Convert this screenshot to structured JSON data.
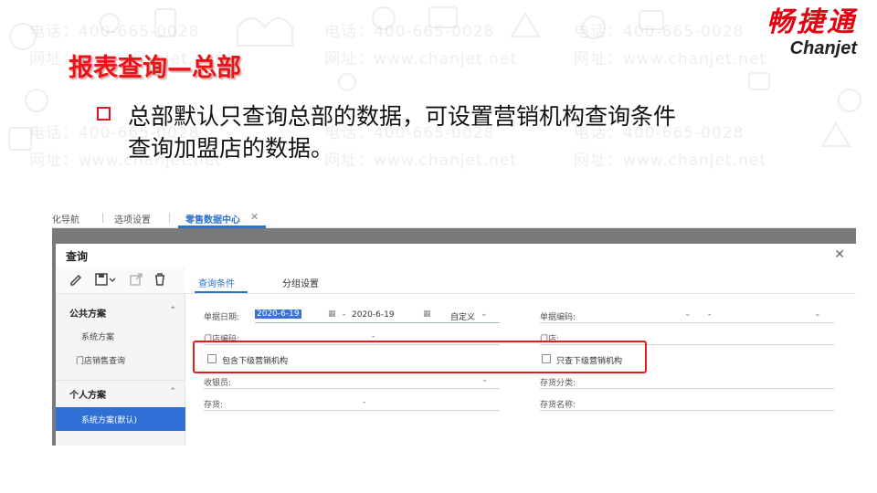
{
  "watermark": {
    "phone": "电话：400-665-0028",
    "url": "网址：www.chanjet.net"
  },
  "logo": {
    "cn": "畅捷通",
    "en": "Chanjet"
  },
  "slide": {
    "title": "报表查询—总部",
    "bullet_line1": "总部默认只查询总部的数据，可设置营销机构查询条件",
    "bullet_line2": "查询加盟店的数据。"
  },
  "app": {
    "tabs": [
      {
        "label": "化导航"
      },
      {
        "label": "选项设置"
      },
      {
        "label": "零售数据中心",
        "active": true
      }
    ],
    "dialog": {
      "title": "查询",
      "toolbar_icons": [
        "edit-icon",
        "save-icon",
        "export-icon",
        "delete-icon"
      ],
      "sections": [
        {
          "label": "公共方案",
          "items": [
            "系统方案",
            "门店销售查询"
          ]
        },
        {
          "label": "个人方案",
          "items": [
            "系统方案(默认)"
          ]
        }
      ],
      "query_tabs": [
        "查询条件",
        "分组设置"
      ],
      "form": {
        "date_label": "单据日期:",
        "date_from": "2020-6-19",
        "date_sep": "-",
        "date_to": "2020-6-19",
        "date_mode": "自定义",
        "doc_no_label": "单据编码:",
        "doc_no_sep": "-",
        "store_code_label": "门店编码:",
        "store_code_sep": "-",
        "store_label": "门店:",
        "include_sub_label": "包含下级营销机构",
        "only_sub_label": "只查下级营销机构",
        "cashier_label": "收银员:",
        "stock_cat_label": "存货分类:",
        "stock_label": "存货:",
        "stock_sep": "-",
        "stock_name_label": "存货名称:"
      }
    }
  },
  "colors": {
    "brand_red": "#e60012",
    "accent_blue": "#2b73c9",
    "highlight_red": "#e02020"
  }
}
